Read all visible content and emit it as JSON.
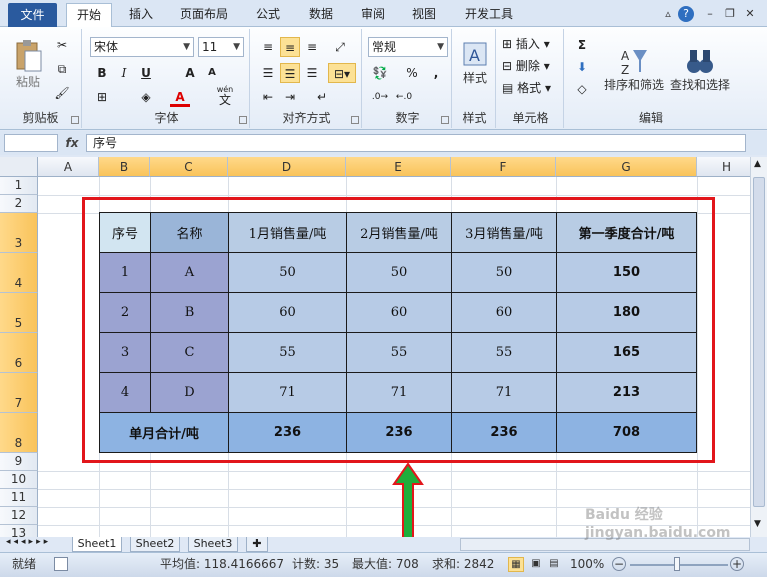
{
  "tabs": {
    "file": "文件",
    "home": "开始",
    "insert": "插入",
    "layout": "页面布局",
    "formula": "公式",
    "data": "数据",
    "review": "审阅",
    "view": "视图",
    "dev": "开发工具"
  },
  "ribbon": {
    "clipboard": {
      "label": "剪贴板",
      "paste": "粘贴"
    },
    "font": {
      "label": "字体",
      "name": "宋体",
      "size": "11",
      "bold": "B",
      "italic": "I",
      "underline": "U",
      "grow": "A",
      "shrink": "A",
      "color_a": "A",
      "wen": "wén",
      "wen_char": "文"
    },
    "align": {
      "label": "对齐方式"
    },
    "number": {
      "label": "数字",
      "format": "常规",
      "percent": "%",
      "comma": ","
    },
    "styles": {
      "label": "样式",
      "btn": "样式"
    },
    "cells": {
      "label": "单元格",
      "insert": "插入",
      "delete": "删除",
      "format": "格式"
    },
    "editing": {
      "label": "编辑",
      "sort": "排序和筛选",
      "find": "查找和选择",
      "sigma": "Σ"
    }
  },
  "formula_bar": {
    "fx": "fx",
    "content": "序号"
  },
  "columns": [
    "A",
    "B",
    "C",
    "D",
    "E",
    "F",
    "G",
    "H"
  ],
  "rows": [
    "1",
    "2",
    "3",
    "4",
    "5",
    "6",
    "7",
    "8",
    "9",
    "10",
    "11",
    "12",
    "13"
  ],
  "table": {
    "header": [
      "序号",
      "名称",
      "1月销售量/吨",
      "2月销售量/吨",
      "3月销售量/吨",
      "第一季度合计/吨"
    ],
    "rows": [
      [
        "1",
        "A",
        "50",
        "50",
        "50",
        "150"
      ],
      [
        "2",
        "B",
        "60",
        "60",
        "60",
        "180"
      ],
      [
        "3",
        "C",
        "55",
        "55",
        "55",
        "165"
      ],
      [
        "4",
        "D",
        "71",
        "71",
        "71",
        "213"
      ]
    ],
    "total": [
      "单月合计/吨",
      "236",
      "236",
      "236",
      "708"
    ]
  },
  "sheets": [
    "Sheet1",
    "Sheet2",
    "Sheet3"
  ],
  "status": {
    "ready": "就绪",
    "avg": "平均值: 118.4166667",
    "count": "计数: 35",
    "max": "最大值: 708",
    "sum": "求和: 2842",
    "zoom": "100%"
  },
  "watermark": "Baidu 经验 jingyan.baidu.com",
  "colors": {
    "red_box": "#e2161b",
    "arrow": "#1fae3b"
  }
}
